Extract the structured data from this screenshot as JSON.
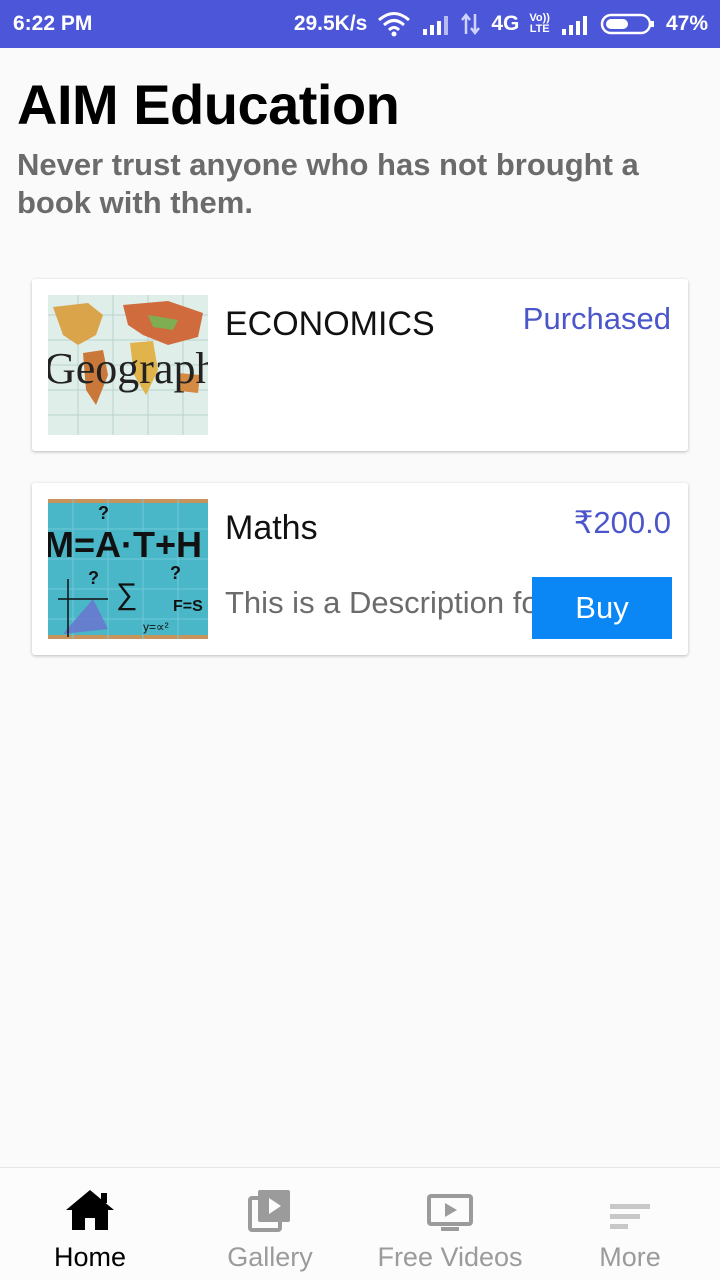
{
  "status_bar": {
    "time": "6:22 PM",
    "speed": "29.5K/s",
    "network": "4G",
    "volte_top": "Vo))",
    "volte_bottom": "LTE",
    "battery": "47%"
  },
  "header": {
    "title": "AIM Education",
    "tagline": "Never trust anyone who has not brought a book with them."
  },
  "courses": [
    {
      "title": "ECONOMICS",
      "status": "Purchased",
      "thumb_text": "Geograph",
      "thumb_icon": "world-map-image"
    },
    {
      "title": "Maths",
      "price": "₹200.0",
      "description": "This is a Description for",
      "buy_label": "Buy",
      "thumb_text": "M=A·T+H",
      "thumb_icon": "math-chalkboard-image"
    }
  ],
  "bottom_nav": [
    {
      "label": "Home",
      "icon": "home-icon",
      "active": true
    },
    {
      "label": "Gallery",
      "icon": "gallery-icon",
      "active": false
    },
    {
      "label": "Free Videos",
      "icon": "video-icon",
      "active": false
    },
    {
      "label": "More",
      "icon": "more-icon",
      "active": false
    }
  ],
  "colors": {
    "status_bar": "#4c56d8",
    "accent_text": "#4a56c9",
    "buy_button": "#0a86f5"
  }
}
